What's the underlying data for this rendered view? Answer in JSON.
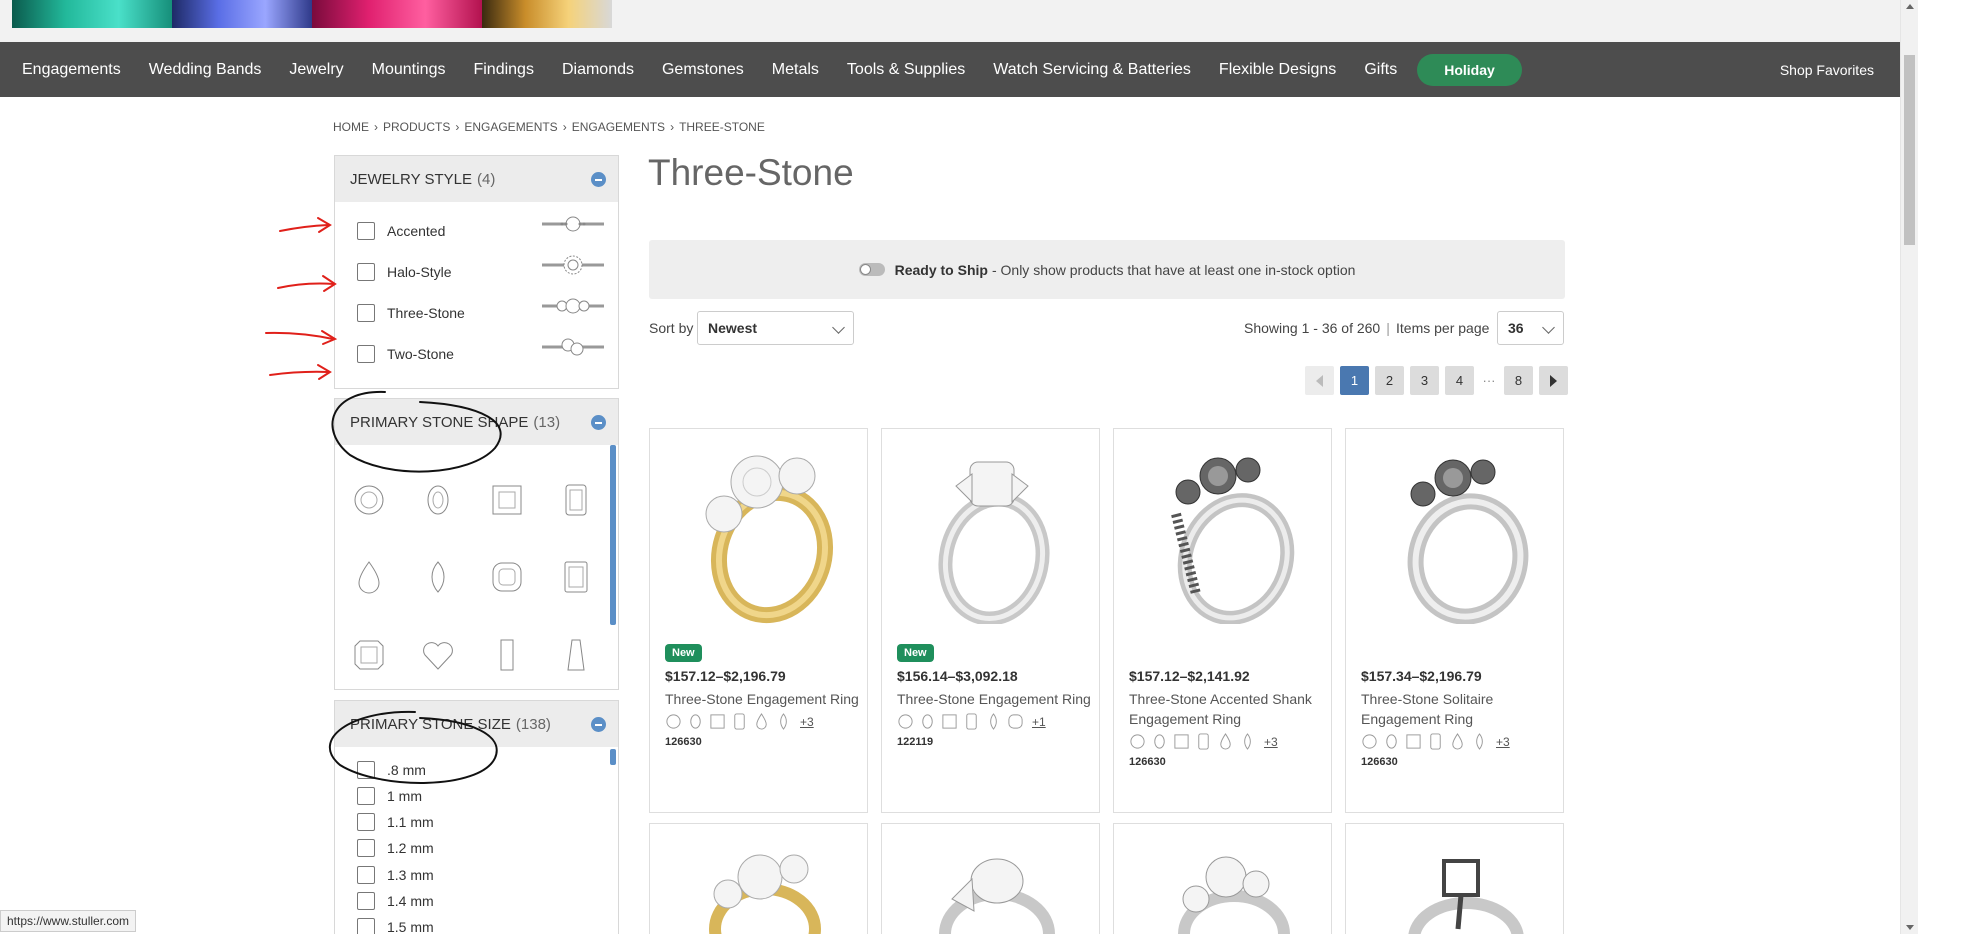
{
  "nav": {
    "items": [
      "Engagements",
      "Wedding Bands",
      "Jewelry",
      "Mountings",
      "Findings",
      "Diamonds",
      "Gemstones",
      "Metals",
      "Tools & Supplies",
      "Watch Servicing & Batteries",
      "Flexible Designs",
      "Gifts"
    ],
    "holiday": "Holiday",
    "shop_favorites": "Shop Favorites"
  },
  "breadcrumb": [
    "HOME",
    "PRODUCTS",
    "ENGAGEMENTS",
    "ENGAGEMENTS",
    "THREE-STONE"
  ],
  "filters": {
    "jewelry_style": {
      "title": "JEWELRY STYLE",
      "count": "(4)",
      "options": [
        "Accented",
        "Halo-Style",
        "Three-Stone",
        "Two-Stone"
      ]
    },
    "primary_stone_shape": {
      "title": "PRIMARY STONE SHAPE",
      "count": "(13)"
    },
    "primary_stone_size": {
      "title": "PRIMARY STONE SIZE",
      "count": "(138)",
      "options": [
        ".8 mm",
        "1 mm",
        "1.1 mm",
        "1.2 mm",
        "1.3 mm",
        "1.4 mm",
        "1.5 mm"
      ]
    }
  },
  "page": {
    "title": "Three-Stone",
    "ready_to_ship_label": "Ready to Ship",
    "ready_to_ship_desc": "- Only show products that have at least one in-stock option",
    "sort_by_label": "Sort by",
    "sort_value": "Newest",
    "showing": "Showing 1 - 36 of 260",
    "divider": "|",
    "items_per_page_label": "Items per page",
    "items_per_page_value": "36"
  },
  "pagination": {
    "pages": [
      "1",
      "2",
      "3",
      "4"
    ],
    "ellipsis": "···",
    "last": "8",
    "current": "1"
  },
  "products": [
    {
      "badge": "New",
      "price": "$157.12–$2,196.79",
      "name": "Three-Stone Engagement Ring",
      "more": "+3",
      "sku": "126630",
      "metal": "yellow"
    },
    {
      "badge": "New",
      "price": "$156.14–$3,092.18",
      "name": "Three-Stone Engagement Ring",
      "more": "+1",
      "sku": "122119",
      "metal": "white"
    },
    {
      "badge": "",
      "price": "$157.12–$2,141.92",
      "name": "Three-Stone Accented Shank Engagement Ring",
      "more": "+3",
      "sku": "126630",
      "metal": "setting"
    },
    {
      "badge": "",
      "price": "$157.34–$2,196.79",
      "name": "Three-Stone Solitaire Engagement Ring",
      "more": "+3",
      "sku": "126630",
      "metal": "setting"
    }
  ],
  "status_url": "https://www.stuller.com",
  "colors": {
    "nav_bg": "#4d4d4d",
    "holiday": "#2e8b57",
    "accent_blue": "#4a78b0",
    "new_badge": "#1f8f5c",
    "annotation_red": "#e0201a"
  }
}
